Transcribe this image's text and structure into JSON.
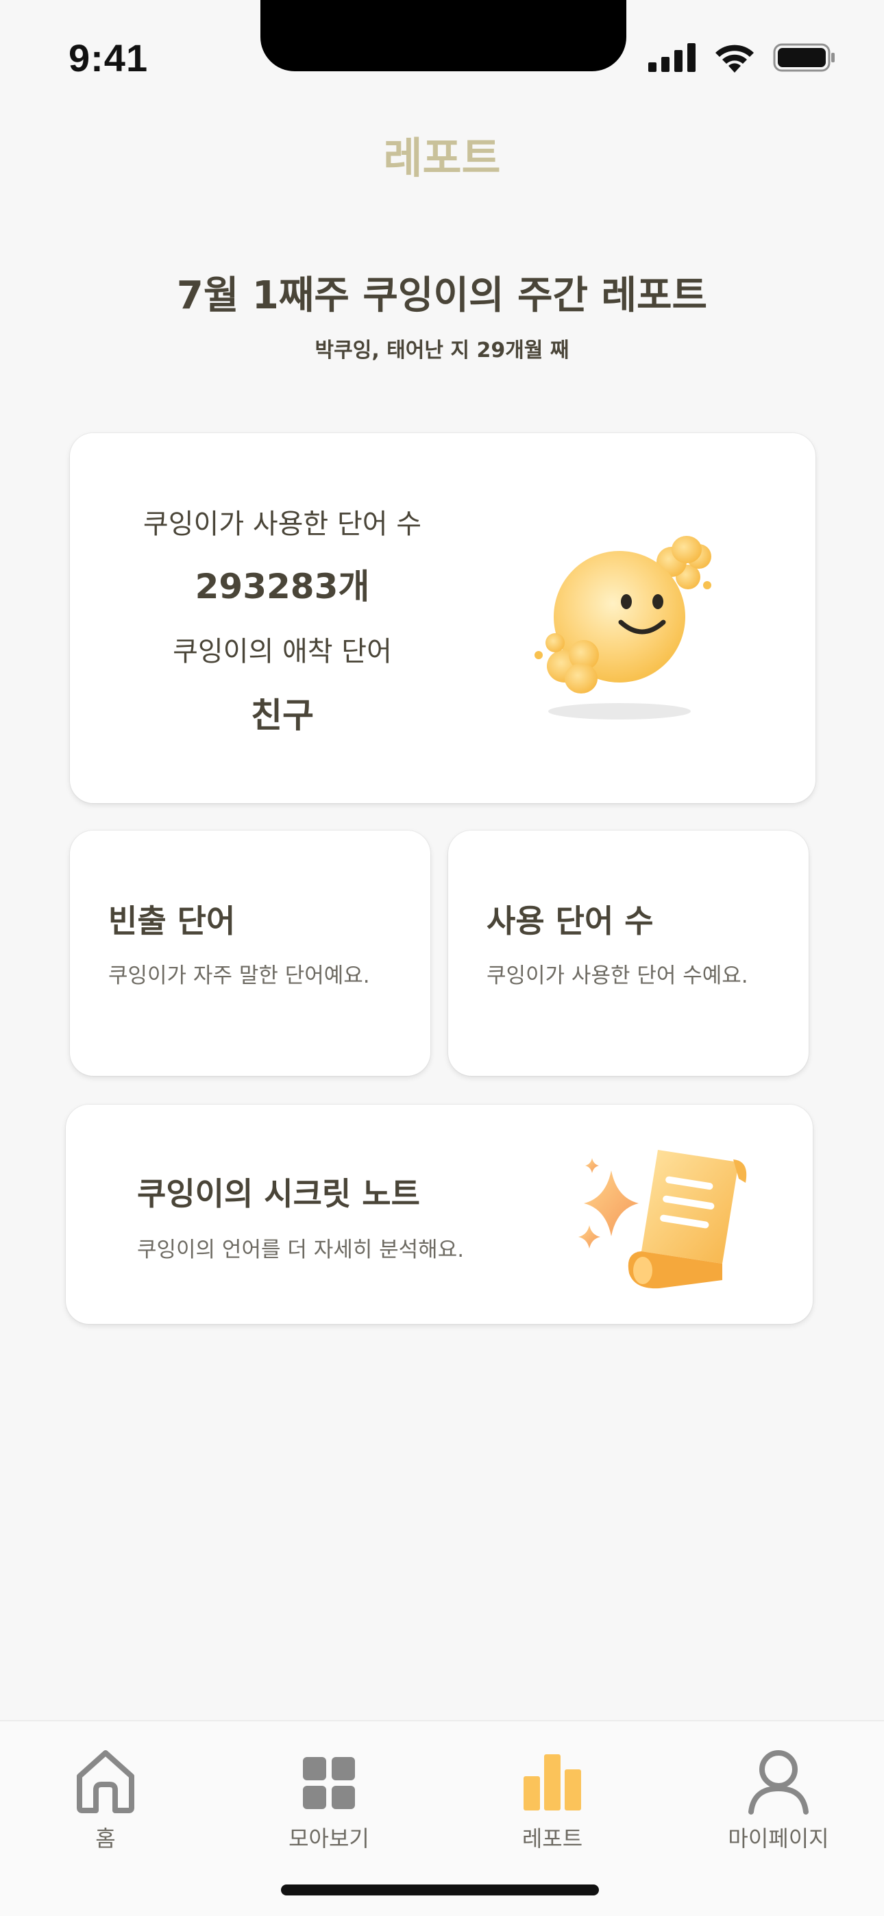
{
  "status_bar": {
    "time": "9:41",
    "icons": [
      "signal-icon",
      "wifi-icon",
      "battery-icon"
    ]
  },
  "header": {
    "title": "레포트"
  },
  "report": {
    "title": "7월 1째주 쿠잉이의 주간 레포트",
    "subtitle": "박쿠잉, 태어난 지 29개월 째"
  },
  "summary": {
    "words_label": "쿠잉이가 사용한 단어 수",
    "words_value": "293283개",
    "favorite_label": "쿠잉이의 애착 단어",
    "favorite_value": "친구"
  },
  "cards": {
    "frequent": {
      "title": "빈출 단어",
      "desc": "쿠잉이가 자주 말한 단어예요."
    },
    "word_count": {
      "title": "사용 단어 수",
      "desc": "쿠잉이가 사용한 단어 수예요."
    },
    "secret_note": {
      "title": "쿠잉이의 시크릿 노트",
      "desc": "쿠잉이의 언어를 더 자세히 분석해요."
    }
  },
  "tabbar": {
    "items": [
      {
        "label": "홈",
        "icon": "home-icon"
      },
      {
        "label": "모아보기",
        "icon": "grid-icon"
      },
      {
        "label": "레포트",
        "icon": "bar-chart-icon",
        "active": true
      },
      {
        "label": "마이페이지",
        "icon": "person-icon"
      }
    ]
  },
  "colors": {
    "accent": "#fbc35a",
    "title_muted": "#c9c19a",
    "text_primary": "#4a4538",
    "background": "#f7f7f7"
  }
}
